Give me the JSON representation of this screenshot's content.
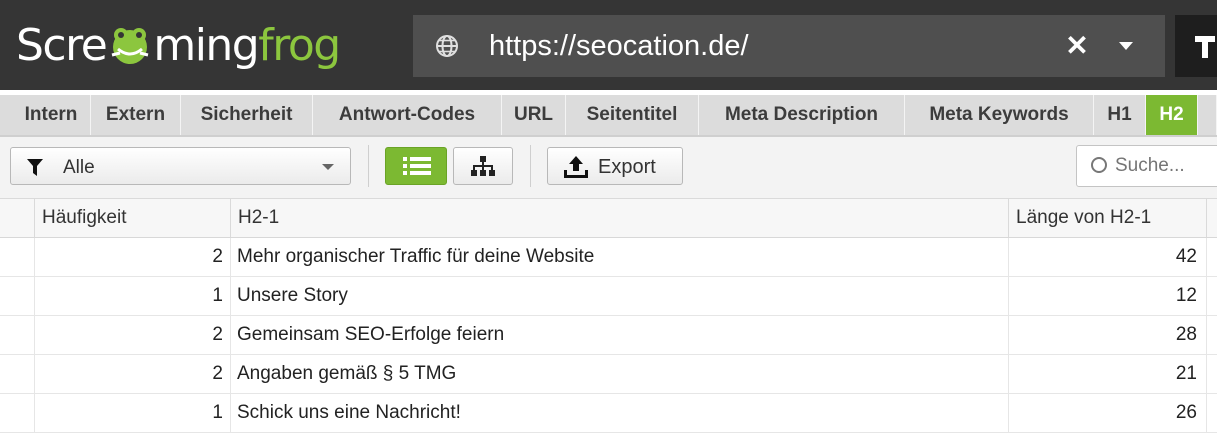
{
  "app": {
    "logo_part1": "Scre",
    "logo_part2": "ming",
    "logo_part3": "frog"
  },
  "url": {
    "value": "https://seocation.de/"
  },
  "tabs": [
    {
      "label": "Intern",
      "active": false
    },
    {
      "label": "Extern",
      "active": false
    },
    {
      "label": "Sicherheit",
      "active": false
    },
    {
      "label": "Antwort-Codes",
      "active": false
    },
    {
      "label": "URL",
      "active": false
    },
    {
      "label": "Seitentitel",
      "active": false
    },
    {
      "label": "Meta Description",
      "active": false
    },
    {
      "label": "Meta Keywords",
      "active": false
    },
    {
      "label": "H1",
      "active": false
    },
    {
      "label": "H2",
      "active": true
    }
  ],
  "toolbar": {
    "filter_label": "Alle",
    "export_label": "Export",
    "search_placeholder": "Suche..."
  },
  "table": {
    "columns": [
      "Häufigkeit",
      "H2-1",
      "Länge von H2-1"
    ],
    "rows": [
      {
        "frequency": "2",
        "h2": "Mehr organischer Traffic für deine Website",
        "length": "42"
      },
      {
        "frequency": "1",
        "h2": "Unsere Story",
        "length": "12"
      },
      {
        "frequency": "2",
        "h2": "Gemeinsam SEO-Erfolge feiern",
        "length": "28"
      },
      {
        "frequency": "2",
        "h2": "Angaben gemäß § 5 TMG",
        "length": "21"
      },
      {
        "frequency": "1",
        "h2": "Schick uns eine Nachricht!",
        "length": "26"
      }
    ]
  },
  "colors": {
    "header_bg": "#353535",
    "url_bg": "#4f4f4f",
    "accent_green": "#7cb932",
    "tab_bg": "#dcdcdc"
  },
  "icons": {
    "logo": "frog-logo-icon",
    "url": "globe-icon",
    "clear": "close-icon",
    "dropdown": "chevron-down-icon",
    "mode": "mode-icon",
    "filter": "filter-icon",
    "list_view": "list-view-icon",
    "tree_view": "tree-view-icon",
    "export": "upload-icon",
    "search": "search-icon"
  }
}
